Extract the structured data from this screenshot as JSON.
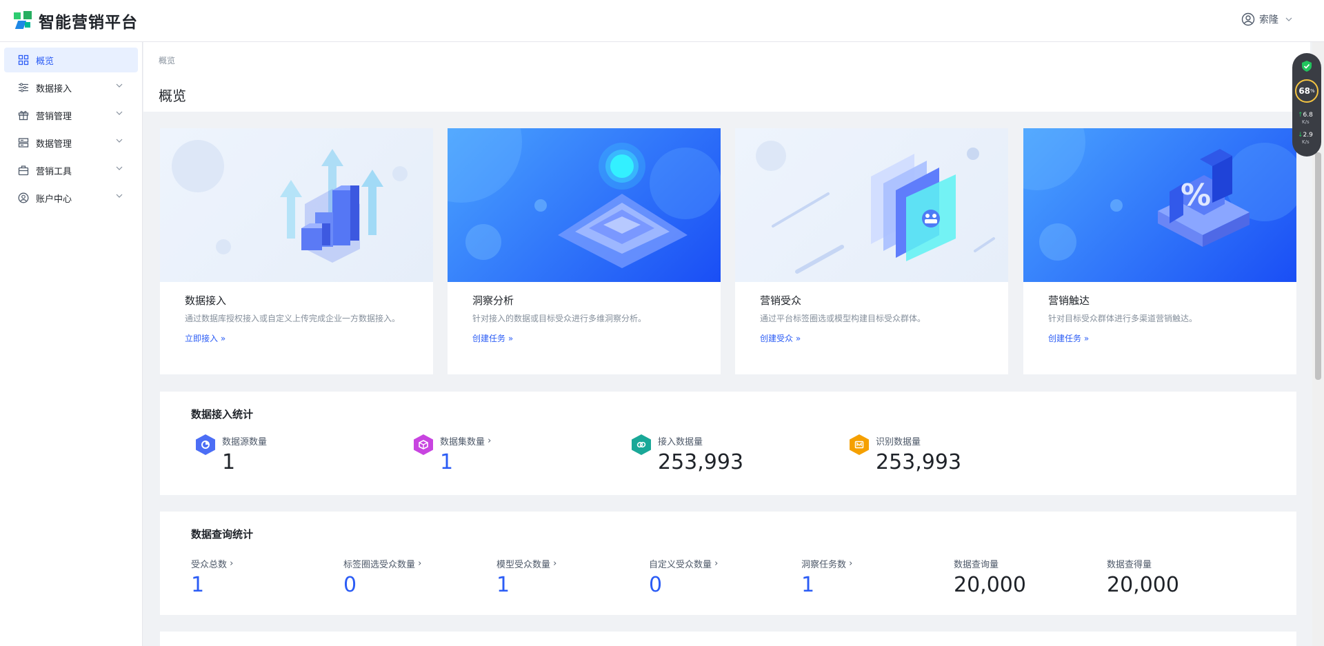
{
  "app": {
    "title": "智能营销平台",
    "user_name": "索隆"
  },
  "sidebar": {
    "items": [
      {
        "label": "概览"
      },
      {
        "label": "数据接入"
      },
      {
        "label": "营销管理"
      },
      {
        "label": "数据管理"
      },
      {
        "label": "营销工具"
      },
      {
        "label": "账户中心"
      }
    ]
  },
  "breadcrumb": "概览",
  "page_title": "概览",
  "cards": [
    {
      "title": "数据接入",
      "desc": "通过数据库授权接入或自定义上传完成企业一方数据接入。",
      "link": "立即接入"
    },
    {
      "title": "洞察分析",
      "desc": "针对接入的数据或目标受众进行多维洞察分析。",
      "link": "创建任务"
    },
    {
      "title": "营销受众",
      "desc": "通过平台标签圈选或模型构建目标受众群体。",
      "link": "创建受众"
    },
    {
      "title": "营销触达",
      "desc": "针对目标受众群体进行多渠道营销触达。",
      "link": "创建任务"
    }
  ],
  "ingest_stats": {
    "title": "数据接入统计",
    "items": [
      {
        "label": "数据源数量",
        "value": "1",
        "has_arrow": false
      },
      {
        "label": "数据集数量",
        "value": "1",
        "has_arrow": true
      },
      {
        "label": "接入数据量",
        "value": "253,993",
        "has_arrow": false
      },
      {
        "label": "识别数据量",
        "value": "253,993",
        "has_arrow": false
      }
    ]
  },
  "query_stats": {
    "title": "数据查询统计",
    "items": [
      {
        "label": "受众总数",
        "value": "1"
      },
      {
        "label": "标签圈选受众数量",
        "value": "0"
      },
      {
        "label": "模型受众数量",
        "value": "1"
      },
      {
        "label": "自定义受众数量",
        "value": "0"
      },
      {
        "label": "洞察任务数",
        "value": "1"
      },
      {
        "label": "数据查询量",
        "value": "20,000"
      },
      {
        "label": "数据查得量",
        "value": "20,000"
      }
    ]
  },
  "widget": {
    "percent": "68",
    "percent_unit": "%",
    "up_speed": "6.8",
    "down_speed": "2.9",
    "speed_unit": "K/s"
  },
  "colors": {
    "accent": "#2b5cf5",
    "active_bg": "#e8f0ff"
  }
}
